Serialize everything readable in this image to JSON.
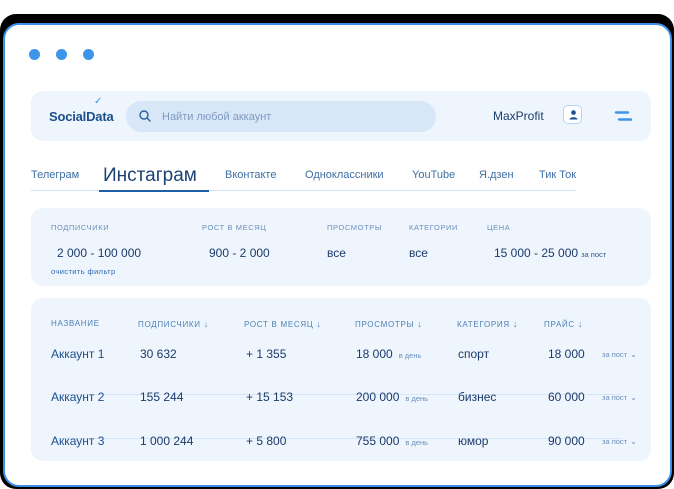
{
  "logo": {
    "text": "SocialData",
    "mark": "✓"
  },
  "search": {
    "placeholder": "Найти любой аккаунт"
  },
  "user": {
    "name": "MaxProfit"
  },
  "tabs": [
    {
      "label": "Телеграм"
    },
    {
      "label": "Инстаграм",
      "active": true
    },
    {
      "label": "Вконтакте"
    },
    {
      "label": "Одноклассники"
    },
    {
      "label": "YouTube"
    },
    {
      "label": "Я.дзен"
    },
    {
      "label": "Тик Ток"
    }
  ],
  "filters": {
    "subscribers": {
      "label": "ПОДПИСЧИКИ",
      "value": "2 000 - 100 000"
    },
    "growth": {
      "label": "РОСТ В МЕСЯЦ",
      "value": "900 - 2 000"
    },
    "views": {
      "label": "ПРОСМОТРЫ",
      "value": "все"
    },
    "category": {
      "label": "КАТЕГОРИИ",
      "value": "все"
    },
    "price": {
      "label": "ЦЕНА",
      "value": "15 000 - 25 000",
      "suffix": "за пост"
    },
    "clear": "очистить фильтр"
  },
  "table": {
    "headers": {
      "name": "НАЗВАНИЕ",
      "subscribers": "ПОДПИСЧИКИ",
      "growth": "РОСТ В МЕСЯЦ",
      "views": "ПРОСМОТРЫ",
      "category": "КАТЕГОРИЯ",
      "price": "ПРАЙС",
      "sort_arrow": "↓"
    },
    "per_day": "в день",
    "per_post": "за пост",
    "chevron": "⌄",
    "rows": [
      {
        "name": "Аккаунт 1",
        "subscribers": "30 632",
        "growth": "+ 1 355",
        "views": "18 000",
        "category": "спорт",
        "price": "18 000"
      },
      {
        "name": "Аккаунт 2",
        "subscribers": "155 244",
        "growth": "+ 15 153",
        "views": "200 000",
        "category": "бизнес",
        "price": "60 000"
      },
      {
        "name": "Аккаунт 3",
        "subscribers": "1 000 244",
        "growth": "+ 5 800",
        "views": "755 000",
        "category": "юмор",
        "price": "90 000"
      }
    ]
  },
  "colors": {
    "accent": "#3d95ea",
    "text": "#1b3a6b",
    "panel": "#eef5fd",
    "frame": "#3b8fe6"
  }
}
